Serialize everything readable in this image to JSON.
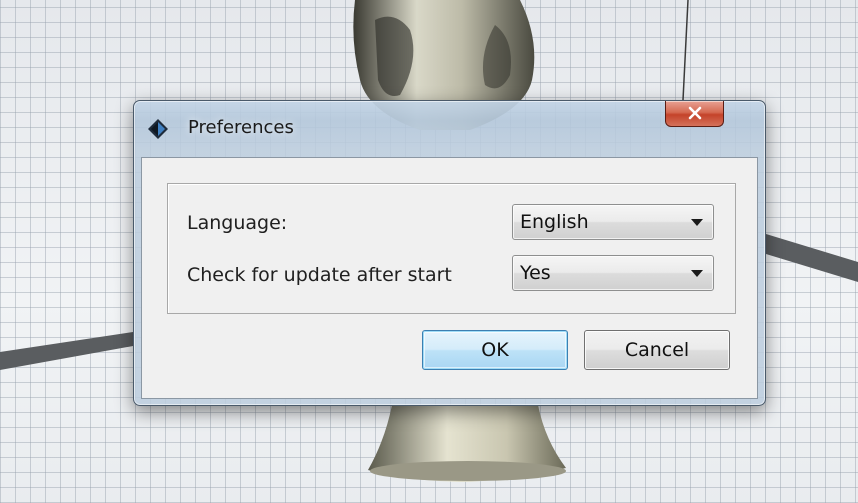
{
  "window": {
    "title": "Preferences",
    "close_label": "X"
  },
  "preferences": {
    "language_label": "Language:",
    "language_value": "English",
    "update_label": "Check for update after start",
    "update_value": "Yes"
  },
  "buttons": {
    "ok_label": "OK",
    "cancel_label": "Cancel"
  },
  "icons": {
    "app": "app-logo-icon",
    "close": "close-icon",
    "dropdown": "chevron-down-icon"
  },
  "colors": {
    "close_button": "#c4432a",
    "ok_button_border": "#3c7fb1",
    "dialog_background": "#f0f0f0"
  }
}
